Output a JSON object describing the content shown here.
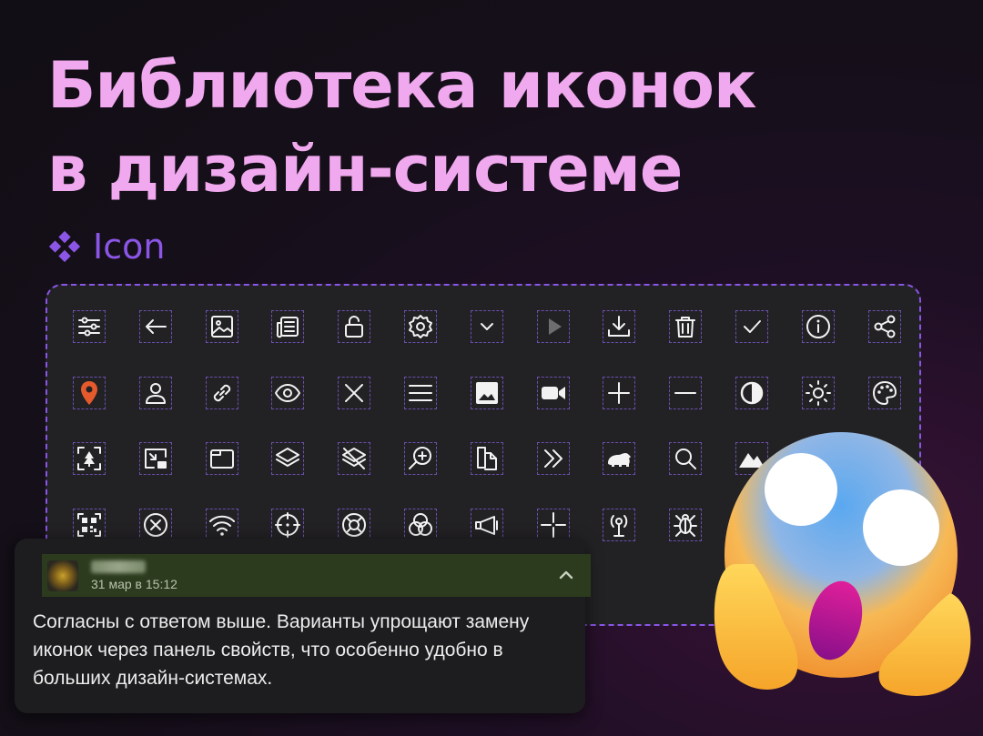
{
  "title": {
    "line1": "Библиотека иконок",
    "line2": "в дизайн-системе"
  },
  "component": {
    "icon": "component-diamond-icon",
    "label": "Icon"
  },
  "accent_colors": {
    "title": "#f0a8ee",
    "component": "#8b55e6",
    "dashed_border": "#8a55e8",
    "location_pin": "#e45a2c"
  },
  "icon_grid": [
    [
      "sliders-icon",
      "arrow-left-icon",
      "image-icon",
      "newspaper-icon",
      "unlock-icon",
      "settings-gear-icon",
      "chevron-down-icon",
      "play-icon",
      "download-icon",
      "trash-icon",
      "check-icon",
      "info-icon",
      "share-icon"
    ],
    [
      "location-pin-icon",
      "user-icon",
      "link-icon",
      "eye-icon",
      "close-x-icon",
      "menu-icon",
      "image-filled-icon",
      "video-camera-icon",
      "plus-icon",
      "minus-icon",
      "contrast-icon",
      "sun-icon",
      "palette-icon"
    ],
    [
      "tree-focus-icon",
      "picture-in-picture-icon",
      "tab-window-icon",
      "layers-icon",
      "layers-off-icon",
      "zoom-in-icon",
      "copy-document-icon",
      "double-chevron-right-icon",
      "bear-icon",
      "search-icon",
      "mountains-icon"
    ],
    [
      "qr-code-icon",
      "circle-x-icon",
      "wifi-icon",
      "crosshair-icon",
      "life-ring-icon",
      "color-filter-icon",
      "megaphone-icon",
      "plus-cursor-icon",
      "antenna-icon",
      "bug-icon"
    ]
  ],
  "comment": {
    "timestamp": "31 мар в 15:12",
    "text": "Согласны с ответом выше. Варианты упрощают замену иконок через панель свойств, что особенно удобно в больших дизайн-системах.",
    "collapse_icon": "chevron-up-icon"
  },
  "decoration": {
    "emoji": "face-screaming-in-fear-emoji"
  }
}
